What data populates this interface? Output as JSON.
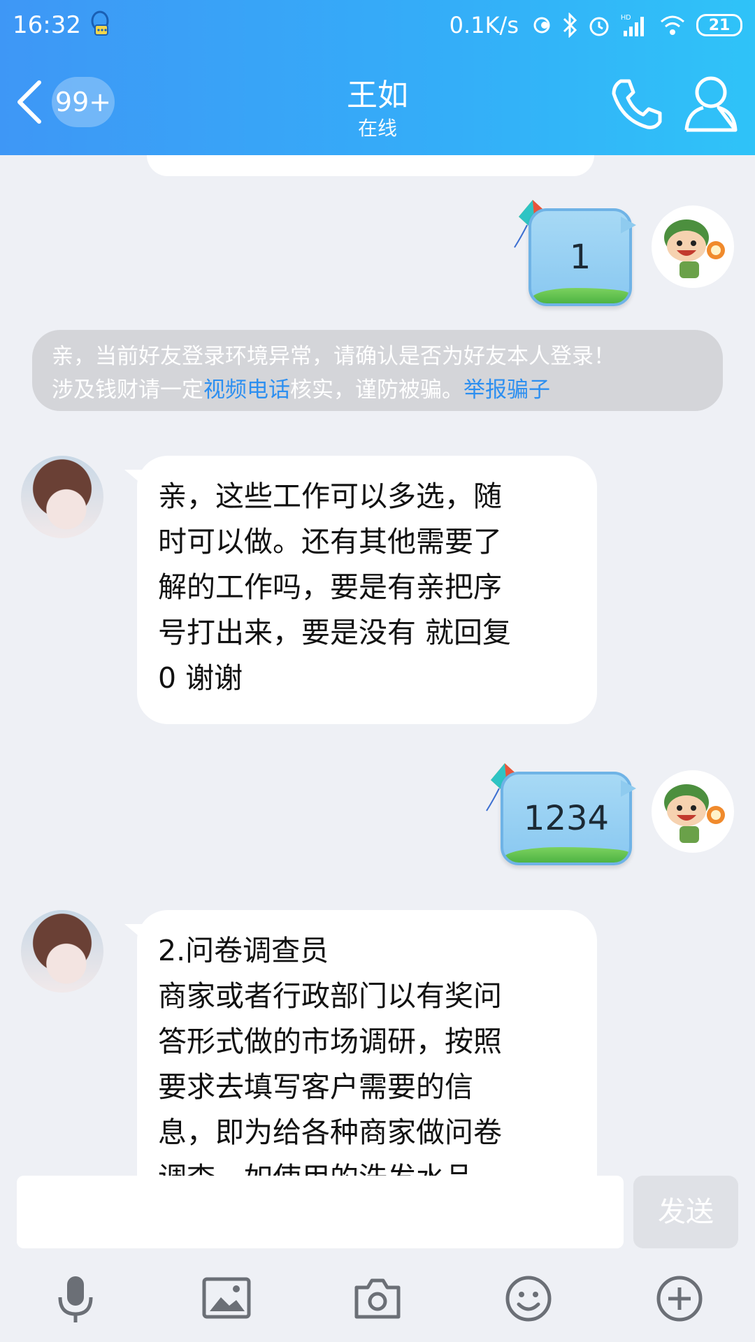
{
  "status_bar": {
    "time": "16:32",
    "net_speed": "0.1K/s",
    "battery": "21",
    "icons": [
      "qq-notification-icon",
      "hd-icon",
      "bluetooth-icon",
      "alarm-icon",
      "signal-icon",
      "wifi-icon",
      "battery-icon"
    ]
  },
  "header": {
    "unread_badge": "99+",
    "contact_name": "王如",
    "contact_status": "在线",
    "colors": {
      "gradient_start": "#3e97f6",
      "gradient_end": "#2fc3f8"
    }
  },
  "messages": [
    {
      "from": "me",
      "type": "sticker-bubble",
      "text": "1"
    },
    {
      "from": "system",
      "type": "notice",
      "line1": "亲，当前好友登录环境异常，请确认是否为好友本人登录！",
      "line2_a": "涉及钱财请一定",
      "line2_link": "视频电话",
      "line2_b": "核实，谨防被骗。",
      "report_link": "举报骗子"
    },
    {
      "from": "her",
      "type": "text",
      "lines": [
        "亲，这些工作可以多选，随",
        "时可以做。还有其他需要了",
        "解的工作吗，要是有亲把序",
        "号打出来，要是没有 就回复",
        "0 谢谢"
      ]
    },
    {
      "from": "me",
      "type": "sticker-bubble",
      "text": "1234"
    },
    {
      "from": "her",
      "type": "text",
      "lines": [
        "2.问卷调查员",
        "商家或者行政部门以有奖问",
        "答形式做的市场调研，按照",
        "要求去填写客户需要的信",
        "息，即为给各种商家做问卷",
        "调查，如使用的洗发水品"
      ]
    }
  ],
  "input": {
    "value": "",
    "send_label": "发送"
  },
  "toolbar": [
    "microphone-icon",
    "image-icon",
    "camera-icon",
    "emoji-icon",
    "plus-icon"
  ],
  "colors": {
    "link": "#2d8ff0",
    "chat_bg": "#eef0f5",
    "notice_bg": "#d4d5d9"
  }
}
